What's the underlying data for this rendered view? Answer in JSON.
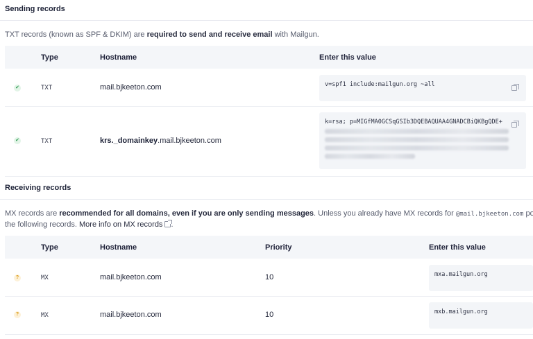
{
  "sending": {
    "title": "Sending records",
    "desc_pre": "TXT records (known as SPF & DKIM) are ",
    "desc_bold": "required to send and receive email",
    "desc_post": " with Mailgun.",
    "headers": {
      "type": "Type",
      "hostname": "Hostname",
      "value": "Enter this value"
    },
    "rows": [
      {
        "status": "verified",
        "type": "TXT",
        "host_bold": "",
        "host": "mail.bjkeeton.com",
        "value": "v=spf1 include:mailgun.org ~all"
      },
      {
        "status": "verified",
        "type": "TXT",
        "host_bold": "krs._domainkey",
        "host": ".mail.bjkeeton.com",
        "value": "k=rsa; p=MIGfMA0GCSqGSIb3DQEBAQUAA4GNADCBiQKBgQDE+"
      }
    ]
  },
  "receiving": {
    "title": "Receiving records",
    "desc_pre": "MX records are ",
    "desc_bold": "recommended for all domains, even if you are only sending messages",
    "desc_mid": ". Unless you already have MX records for ",
    "desc_code": "@mail.bjkeeton.com",
    "desc_post": " poin",
    "desc_line2": "the following records. ",
    "desc_link": "More info on MX records",
    "desc_end": ".",
    "headers": {
      "type": "Type",
      "hostname": "Hostname",
      "priority": "Priority",
      "value": "Enter this value"
    },
    "rows": [
      {
        "status": "unverified",
        "type": "MX",
        "host": "mail.bjkeeton.com",
        "priority": "10",
        "value": "mxa.mailgun.org"
      },
      {
        "status": "unverified",
        "type": "MX",
        "host": "mail.bjkeeton.com",
        "priority": "10",
        "value": "mxb.mailgun.org"
      }
    ]
  },
  "icons": {
    "verified": "✔",
    "unverified": "?",
    "copy": "copy-icon",
    "external": "external-link-icon"
  },
  "colors": {
    "verified": "#2f9b52",
    "unverified": "#d99a14",
    "header_bg": "#f4f6f9",
    "value_bg": "#f3f5f8"
  }
}
